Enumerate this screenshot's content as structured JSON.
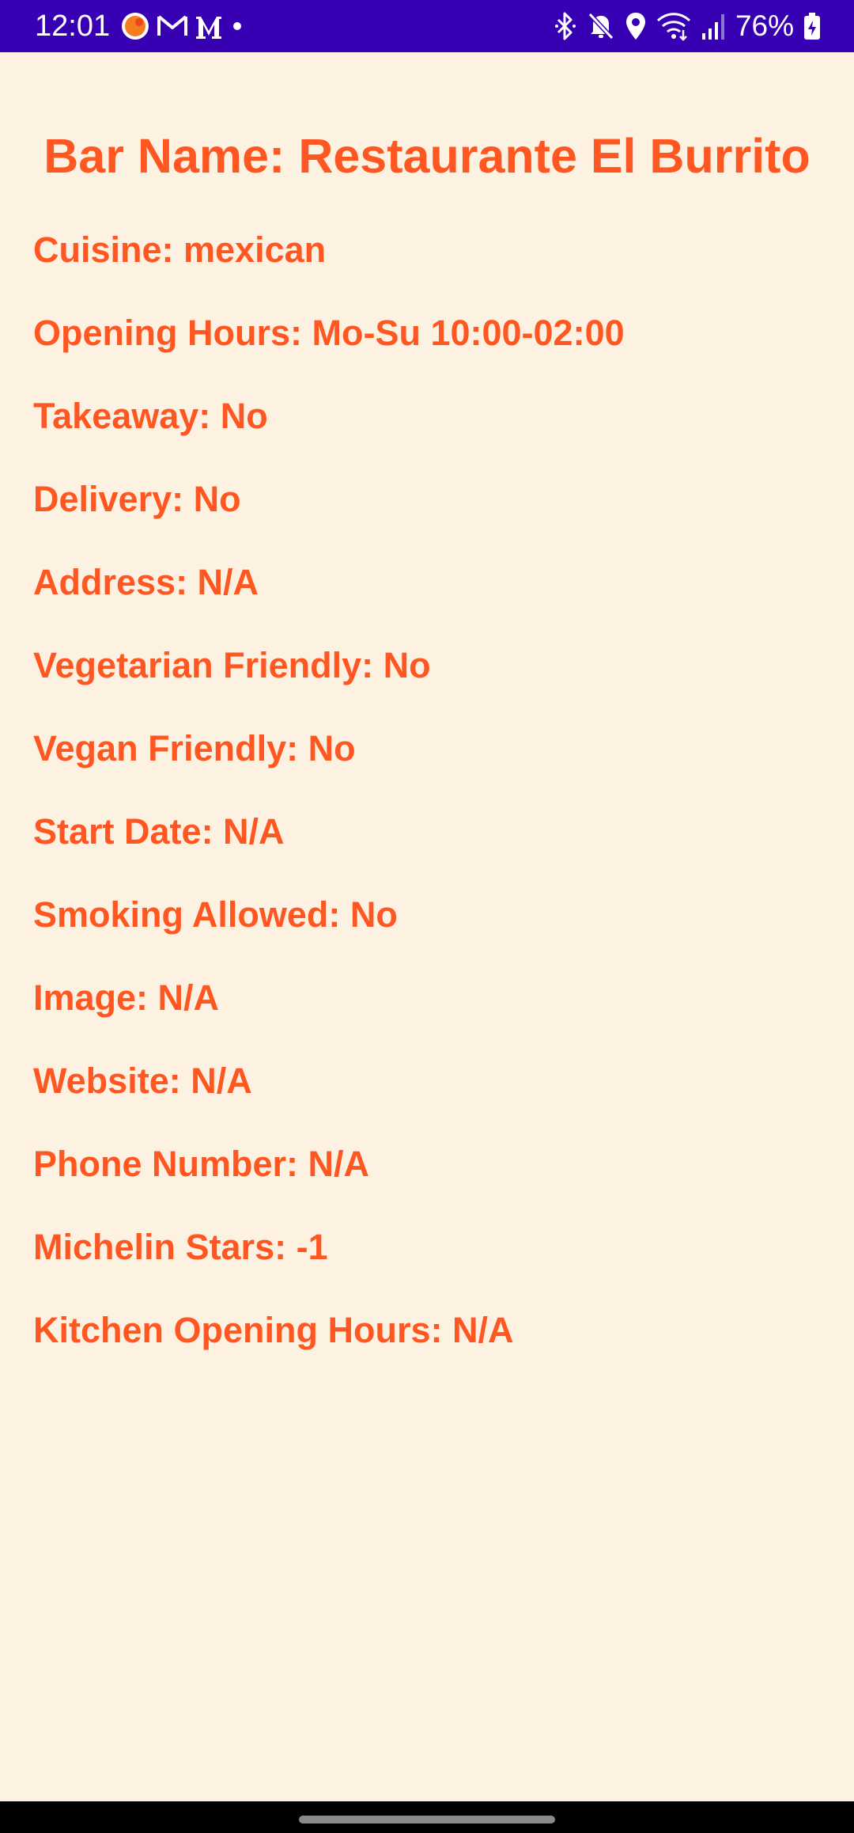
{
  "status_bar": {
    "time": "12:01",
    "battery": "76%",
    "left_icons": [
      "app-notification-icon",
      "gmail-icon",
      "medium-icon",
      "dot-icon"
    ],
    "right_icons": [
      "bluetooth-icon",
      "mute-icon",
      "location-icon",
      "wifi-icon",
      "signal-icon",
      "battery-icon"
    ]
  },
  "colors": {
    "status_bar": "#3700B3",
    "background": "#FDF1E1",
    "text": "#FF5722"
  },
  "title": "Bar Name: Restaurante El Burrito",
  "fields": [
    "Cuisine: mexican",
    "Opening Hours: Mo-Su 10:00-02:00",
    "Takeaway: No",
    "Delivery: No",
    "Address: N/A",
    "Vegetarian Friendly: No",
    "Vegan Friendly: No",
    "Start Date: N/A",
    "Smoking Allowed: No",
    "Image: N/A",
    "Website: N/A",
    "Phone Number: N/A",
    "Michelin Stars: -1",
    "Kitchen Opening Hours: N/A"
  ]
}
